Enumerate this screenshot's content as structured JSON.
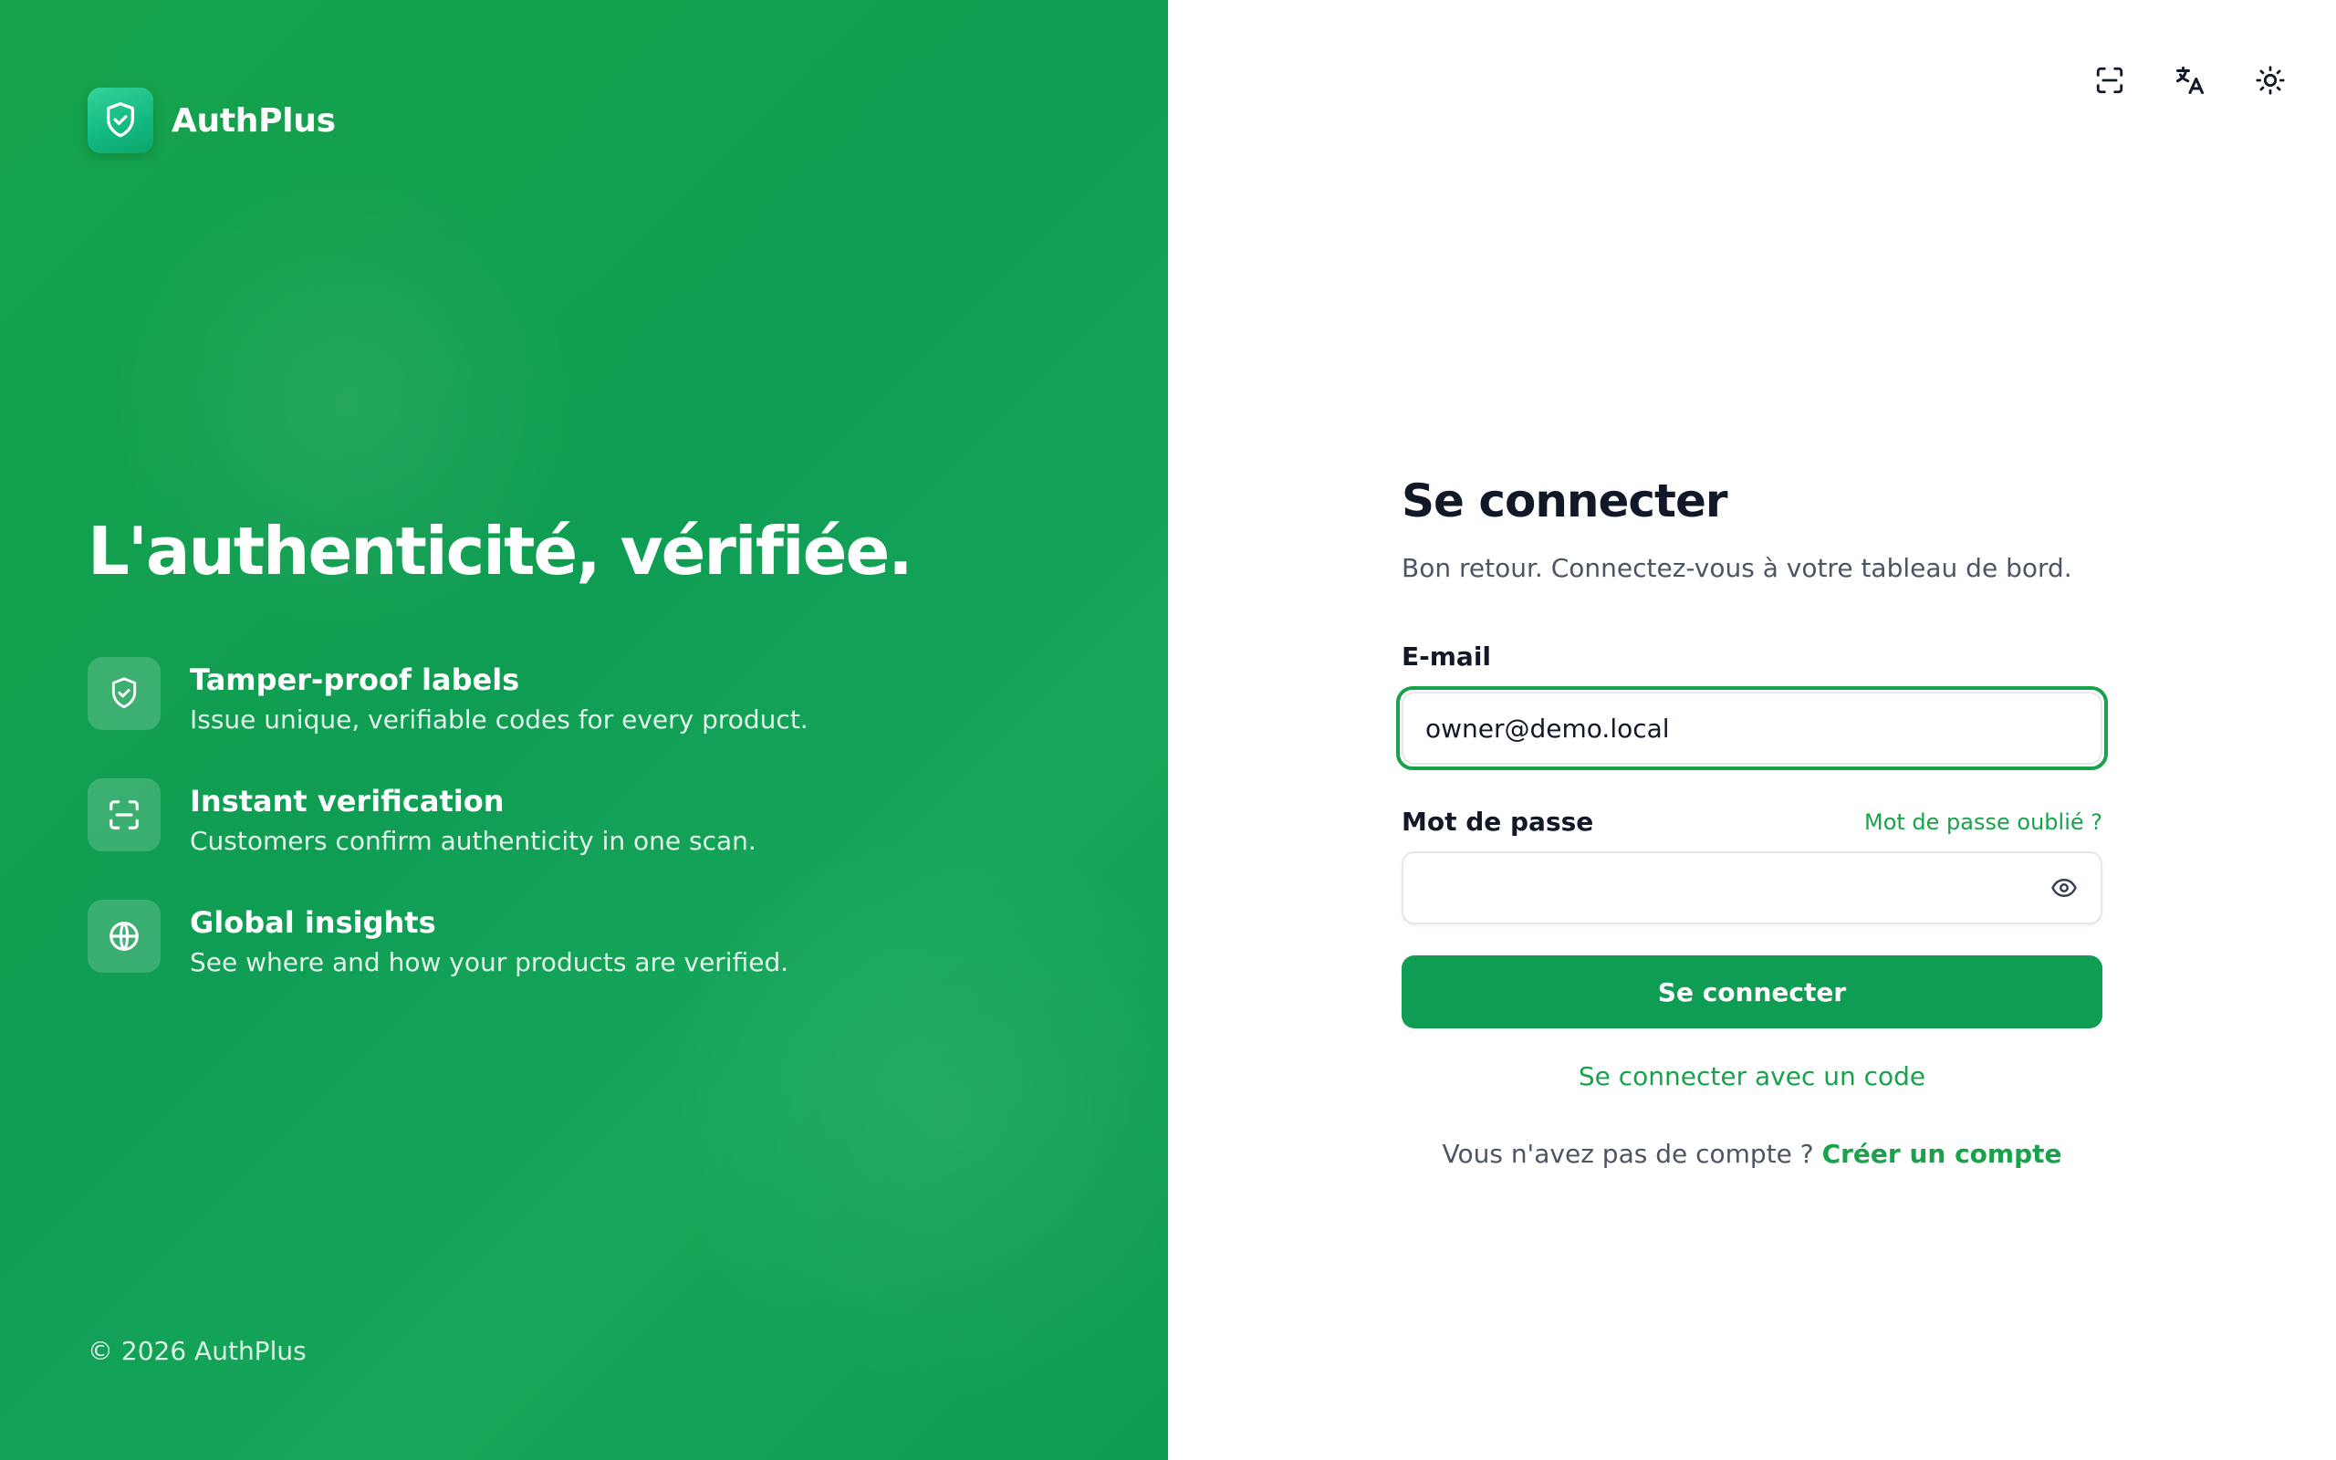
{
  "colors": {
    "brand": "#0f9d53",
    "accent": "#16a34a",
    "text_primary": "#111827",
    "text_secondary": "#4b5563"
  },
  "brand": {
    "name": "AuthPlus",
    "logo_icon": "shield-check-icon"
  },
  "hero": {
    "title": "L'authenticité, vérifiée.",
    "features": [
      {
        "icon": "shield-check-icon",
        "title": "Tamper-proof labels",
        "desc": "Issue unique, verifiable codes for every product."
      },
      {
        "icon": "scan-icon",
        "title": "Instant verification",
        "desc": "Customers confirm authenticity in one scan."
      },
      {
        "icon": "globe-icon",
        "title": "Global insights",
        "desc": "See where and how your products are verified."
      }
    ],
    "copyright": "© 2026 AuthPlus"
  },
  "toolbar": {
    "icons": [
      "scan-icon",
      "translate-icon",
      "theme-toggle-icon"
    ]
  },
  "form": {
    "title": "Se connecter",
    "subtitle": "Bon retour. Connectez-vous à votre tableau de bord.",
    "email_label": "E-mail",
    "email_value": "owner@demo.local",
    "password_label": "Mot de passe",
    "password_value": "",
    "forgot_link": "Mot de passe oublié ?",
    "submit_label": "Se connecter",
    "code_link": "Se connecter avec un code",
    "signup_prompt": "Vous n'avez pas de compte ?",
    "signup_link": "Créer un compte"
  }
}
